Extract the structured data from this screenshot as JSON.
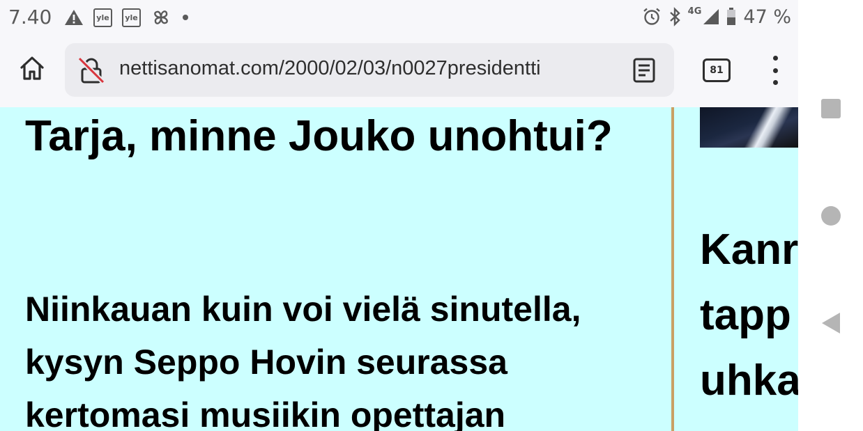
{
  "status_bar": {
    "time": "7.40",
    "notification_icons": [
      "warning-icon",
      "yle-icon",
      "yle-icon",
      "pinwheel-icon",
      "more-notifications-dot"
    ],
    "yle_label": "yle",
    "network": "4G",
    "battery": "47 %"
  },
  "browser": {
    "url": "nettisanomat.com/2000/02/03/n0027presidentti",
    "tab_count": "81",
    "icons": {
      "home": "home-icon",
      "security": "not-secure-lock-icon",
      "reader": "reader-mode-icon",
      "menu": "overflow-menu-icon"
    }
  },
  "article": {
    "headline": "Tarja, minne Jouko unohtui?",
    "lead": "Niinkauan kuin voi vielä sinutella, kysyn Seppo Hovin seurassa kertomasi musiikin opettajan"
  },
  "sidebar": {
    "headline": "Kanr\ntapp\nuhka"
  },
  "navigation_bar": {
    "buttons": [
      "recent-apps-icon",
      "home-circle-icon",
      "back-triangle-icon"
    ]
  },
  "colors": {
    "page_background": "#ccffff",
    "divider": "#c9a064",
    "chrome_background": "#f7f7fa",
    "url_bar": "#ebebef",
    "system_icon": "#5a5a5a",
    "nav_icon": "#b5b5b5"
  }
}
